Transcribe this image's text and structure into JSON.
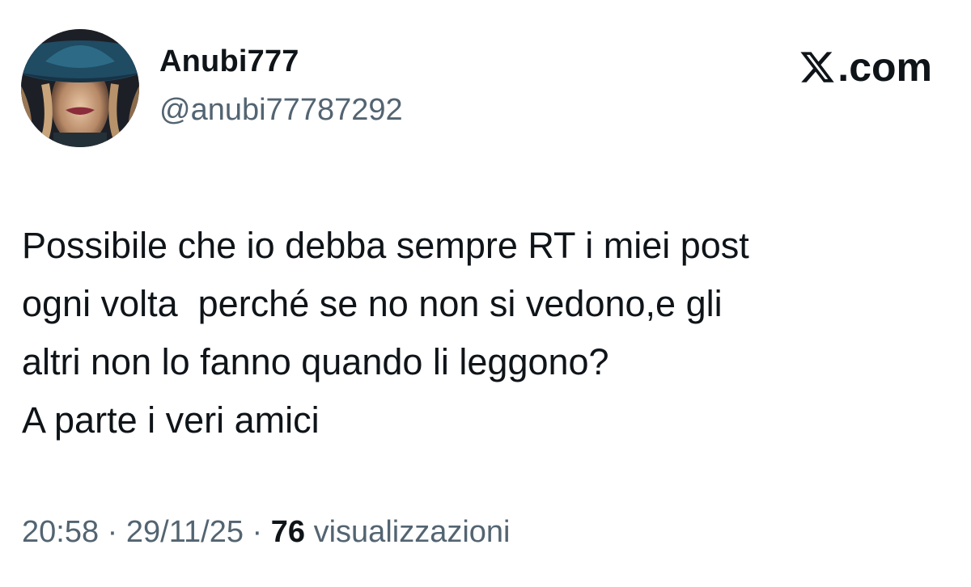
{
  "author": {
    "display_name": "Anubi777",
    "handle": "@anubi77787292",
    "avatar_icon": "avatar-woman-hat"
  },
  "brand": {
    "logo_icon": "x-logo-icon",
    "suffix": ".com"
  },
  "tweet": {
    "lines": [
      "Possibile che io debba sempre RT i miei post",
      "ogni volta  perché se no non si vedono,e gli",
      "altri non lo fanno quando li leggono?",
      "A parte i veri amici"
    ]
  },
  "meta": {
    "time": "20:58",
    "separator": "·",
    "date": "29/11/25",
    "views_count": "76",
    "views_label": "visualizzazioni"
  },
  "colors": {
    "text_primary": "#0f1419",
    "text_secondary": "#536471",
    "background": "#ffffff"
  }
}
